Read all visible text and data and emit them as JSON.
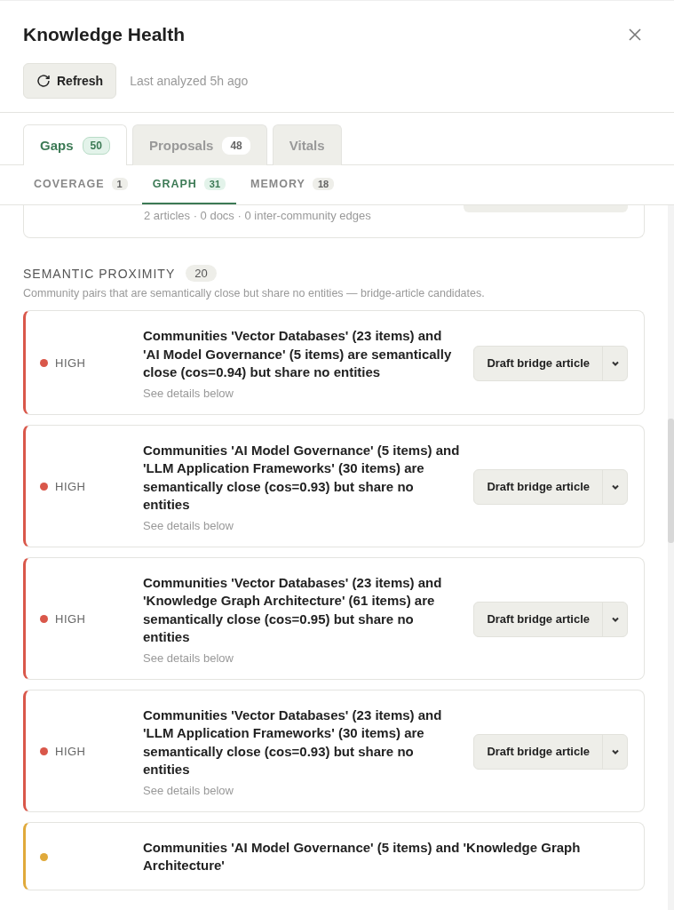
{
  "header": {
    "title": "Knowledge Health",
    "refresh_label": "Refresh",
    "last_analyzed": "Last analyzed 5h ago"
  },
  "tabs": [
    {
      "label": "Gaps",
      "count": "50",
      "selected": true
    },
    {
      "label": "Proposals",
      "count": "48",
      "selected": false
    },
    {
      "label": "Vitals",
      "selected": false
    }
  ],
  "subtabs": [
    {
      "label": "COVERAGE",
      "count": "1",
      "selected": false
    },
    {
      "label": "GRAPH",
      "count": "31",
      "selected": true
    },
    {
      "label": "MEMORY",
      "count": "18",
      "selected": false
    }
  ],
  "partial_card": {
    "meta": "2 articles · 0 docs · 0 inter-community edges"
  },
  "section": {
    "title": "SEMANTIC PROXIMITY",
    "count": "20",
    "description": "Community pairs that are semantically close but share no entities — bridge-article candidates."
  },
  "cards": [
    {
      "severity_label": "HIGH",
      "color": "#d9574a",
      "text": "Communities 'Vector Databases' (23 items) and 'AI Model Governance' (5 items) are semantically close (cos=0.94) but share no entities",
      "details": "See details below",
      "action": "Draft bridge article"
    },
    {
      "severity_label": "HIGH",
      "color": "#d9574a",
      "text": "Communities 'AI Model Governance' (5 items) and 'LLM Application Frameworks' (30 items) are semantically close (cos=0.93) but share no entities",
      "details": "See details below",
      "action": "Draft bridge article"
    },
    {
      "severity_label": "HIGH",
      "color": "#d9574a",
      "text": "Communities 'Vector Databases' (23 items) and 'Knowledge Graph Architecture' (61 items) are semantically close (cos=0.95) but share no entities",
      "details": "See details below",
      "action": "Draft bridge article"
    },
    {
      "severity_label": "HIGH",
      "color": "#d9574a",
      "text": "Communities 'Vector Databases' (23 items) and 'LLM Application Frameworks' (30 items) are semantically close (cos=0.93) but share no entities",
      "details": "See details below",
      "action": "Draft bridge article"
    },
    {
      "color": "#e0a93a",
      "text": "Communities 'AI Model Governance' (5 items) and 'Knowledge Graph Architecture'"
    }
  ]
}
